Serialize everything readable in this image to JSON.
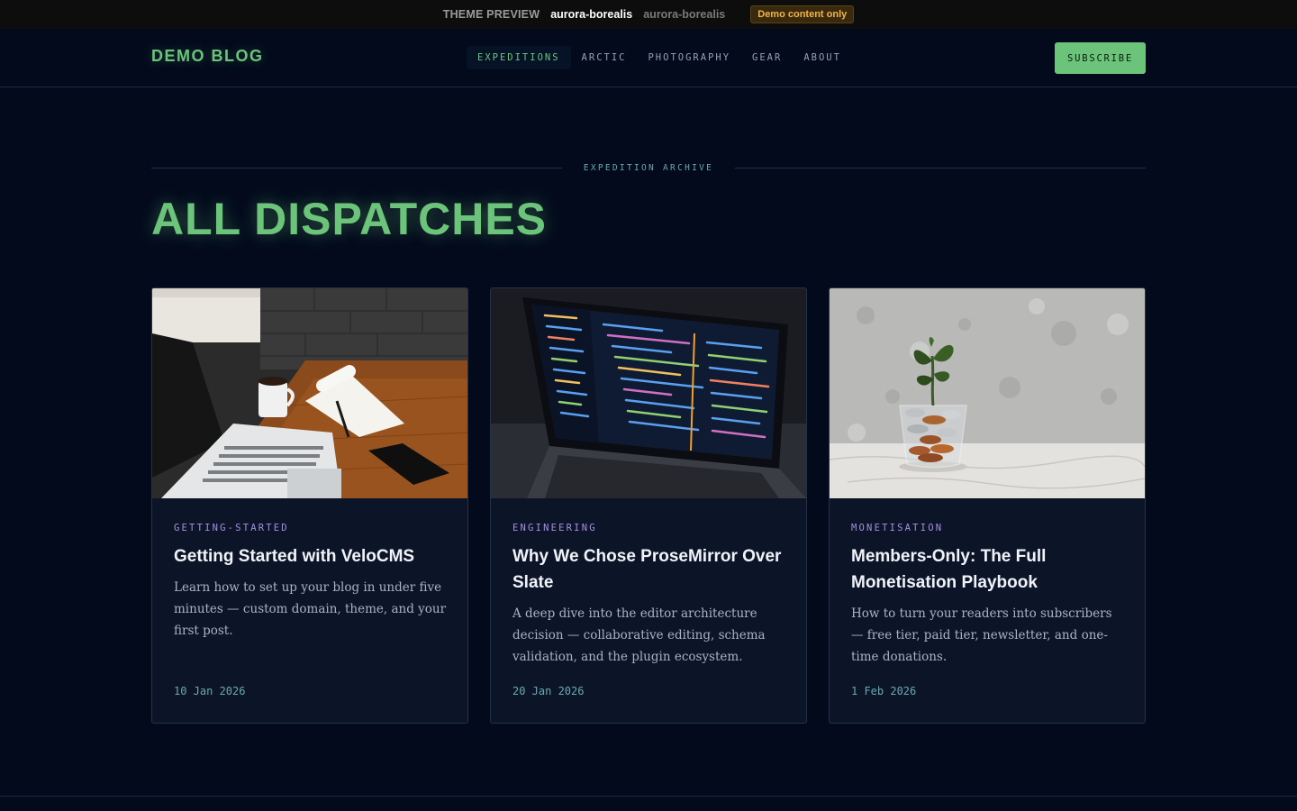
{
  "preview_bar": {
    "label": "THEME PREVIEW",
    "active_theme": "aurora-borealis",
    "other_theme": "aurora-borealis",
    "badge": "Demo content only"
  },
  "header": {
    "logo": "DEMO BLOG",
    "nav": [
      "EXPEDITIONS",
      "ARCTIC",
      "PHOTOGRAPHY",
      "GEAR",
      "ABOUT"
    ],
    "subscribe": "SUBSCRIBE"
  },
  "archive": {
    "label": "EXPEDITION ARCHIVE",
    "title": "ALL DISPATCHES"
  },
  "posts": [
    {
      "category": "GETTING-STARTED",
      "title": "Getting Started with VeloCMS",
      "excerpt": "Learn how to set up your blog in under five minutes — custom domain, theme, and your first post.",
      "date": "10 Jan 2026"
    },
    {
      "category": "ENGINEERING",
      "title": "Why We Chose ProseMirror Over Slate",
      "excerpt": "A deep dive into the editor architecture decision — collaborative editing, schema validation, and the plugin ecosystem.",
      "date": "20 Jan 2026"
    },
    {
      "category": "MONETISATION",
      "title": "Members-Only: The Full Monetisation Playbook",
      "excerpt": "How to turn your readers into subscribers — free tier, paid tier, newsletter, and one-time donations.",
      "date": "1 Feb 2026"
    }
  ],
  "colors": {
    "background": "#030a1c",
    "accent_green": "#6cc47a",
    "category_purple": "#a58fe0",
    "date_teal": "#6aa7b0",
    "badge_amber": "#f2b34b"
  }
}
